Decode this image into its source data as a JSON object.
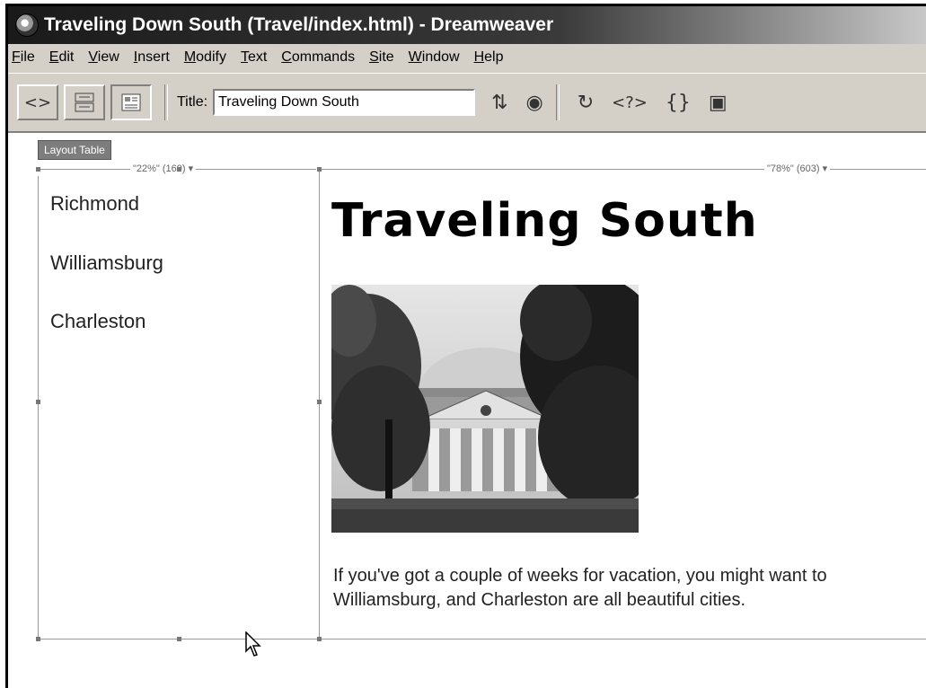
{
  "window": {
    "title": "Traveling Down South (Travel/index.html) - Dreamweaver"
  },
  "menu": [
    {
      "key": "F",
      "rest": "ile"
    },
    {
      "key": "E",
      "rest": "dit"
    },
    {
      "key": "V",
      "rest": "iew"
    },
    {
      "key": "I",
      "rest": "nsert"
    },
    {
      "key": "M",
      "rest": "odify"
    },
    {
      "key": "T",
      "rest": "ext"
    },
    {
      "key": "C",
      "rest": "ommands"
    },
    {
      "key": "S",
      "rest": "ite"
    },
    {
      "key": "W",
      "rest": "indow"
    },
    {
      "key": "H",
      "rest": "elp"
    }
  ],
  "toolbar": {
    "title_label": "Title:",
    "title_value": "Traveling Down South",
    "view_buttons": [
      "code-view-icon",
      "split-view-icon",
      "design-view-icon"
    ],
    "icons": [
      "file-management-icon",
      "preview-browser-icon",
      "refresh-icon",
      "code-navigation-icon",
      "braces-icon",
      "view-options-icon"
    ]
  },
  "layout": {
    "tab_label": "Layout Table",
    "col1_header": "\"22%\" (169) ▾",
    "col2_header": "\"78%\" (603) ▾"
  },
  "nav": [
    "Richmond",
    "Williamsburg",
    "Charleston"
  ],
  "content": {
    "heading": "Traveling South",
    "paragraph_line1": "If you've got a couple of weeks for vacation, you might want to",
    "paragraph_line2": "Williamsburg, and Charleston are all beautiful cities."
  }
}
